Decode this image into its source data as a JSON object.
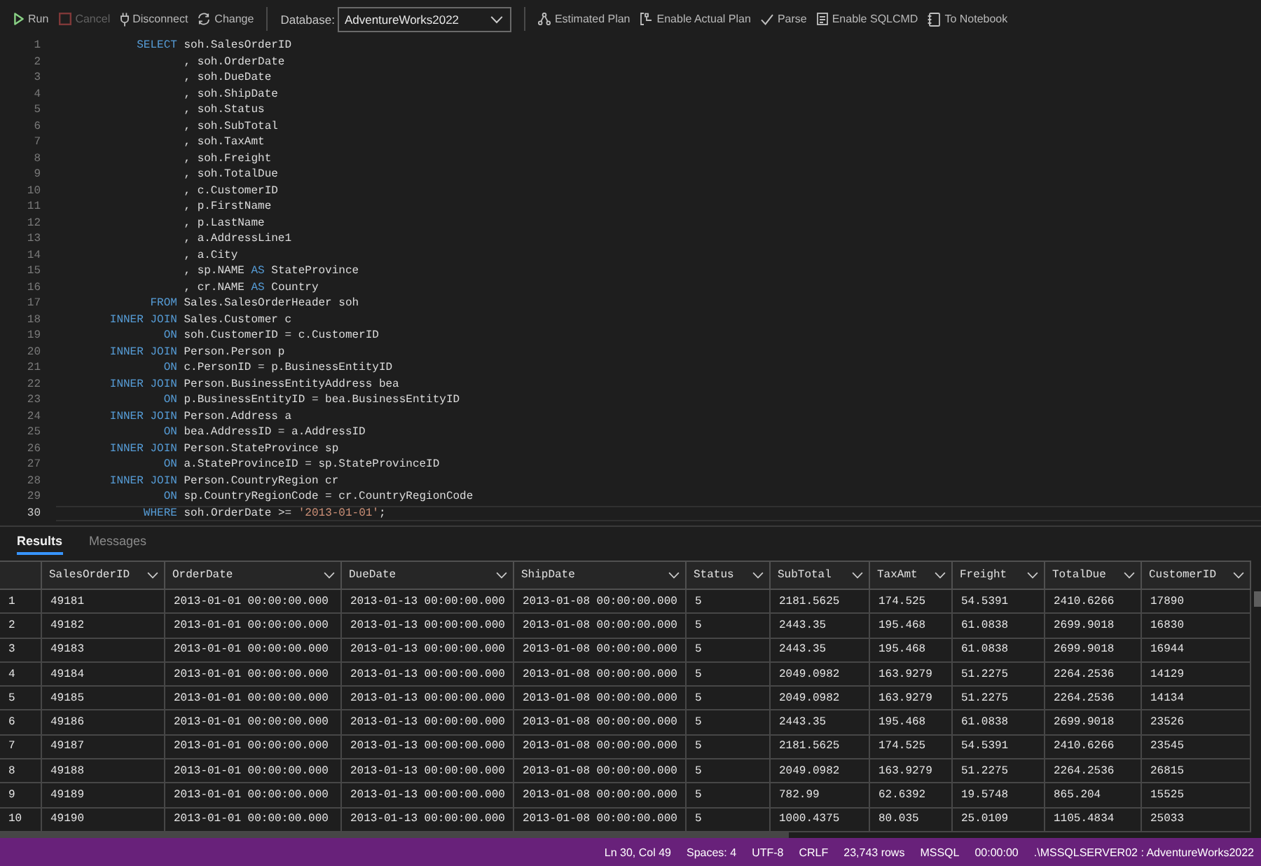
{
  "toolbar": {
    "left_buttons": [
      {
        "label": "Run",
        "disabled": false
      },
      {
        "label": "Cancel",
        "disabled": true
      },
      {
        "label": "Disconnect",
        "disabled": false
      },
      {
        "label": "Change",
        "disabled": false
      }
    ],
    "database": {
      "label": "Database:",
      "value": "AdventureWorks2022"
    },
    "right_buttons": [
      {
        "label": "Estimated Plan"
      },
      {
        "label": "Enable Actual Plan"
      },
      {
        "label": "Parse"
      },
      {
        "label": "Enable SQLCMD"
      },
      {
        "label": "To Notebook"
      }
    ]
  },
  "editor": {
    "lines": [
      {
        "number": "1",
        "current": false,
        "tokens": [
          {
            "kind": "keyword",
            "text": "            SELECT"
          },
          {
            "kind": "plain",
            "text": " soh.SalesOrderID"
          }
        ]
      },
      {
        "number": "2",
        "current": false,
        "tokens": [
          {
            "kind": "plain",
            "text": "                   , soh.OrderDate"
          }
        ]
      },
      {
        "number": "3",
        "current": false,
        "tokens": [
          {
            "kind": "plain",
            "text": "                   , soh.DueDate"
          }
        ]
      },
      {
        "number": "4",
        "current": false,
        "tokens": [
          {
            "kind": "plain",
            "text": "                   , soh.ShipDate"
          }
        ]
      },
      {
        "number": "5",
        "current": false,
        "tokens": [
          {
            "kind": "plain",
            "text": "                   , soh.Status"
          }
        ]
      },
      {
        "number": "6",
        "current": false,
        "tokens": [
          {
            "kind": "plain",
            "text": "                   , soh.SubTotal"
          }
        ]
      },
      {
        "number": "7",
        "current": false,
        "tokens": [
          {
            "kind": "plain",
            "text": "                   , soh.TaxAmt"
          }
        ]
      },
      {
        "number": "8",
        "current": false,
        "tokens": [
          {
            "kind": "plain",
            "text": "                   , soh.Freight"
          }
        ]
      },
      {
        "number": "9",
        "current": false,
        "tokens": [
          {
            "kind": "plain",
            "text": "                   , soh.TotalDue"
          }
        ]
      },
      {
        "number": "10",
        "current": false,
        "tokens": [
          {
            "kind": "plain",
            "text": "                   , c.CustomerID"
          }
        ]
      },
      {
        "number": "11",
        "current": false,
        "tokens": [
          {
            "kind": "plain",
            "text": "                   , p.FirstName"
          }
        ]
      },
      {
        "number": "12",
        "current": false,
        "tokens": [
          {
            "kind": "plain",
            "text": "                   , p.LastName"
          }
        ]
      },
      {
        "number": "13",
        "current": false,
        "tokens": [
          {
            "kind": "plain",
            "text": "                   , a.AddressLine1"
          }
        ]
      },
      {
        "number": "14",
        "current": false,
        "tokens": [
          {
            "kind": "plain",
            "text": "                   , a.City"
          }
        ]
      },
      {
        "number": "15",
        "current": false,
        "tokens": [
          {
            "kind": "plain",
            "text": "                   , sp.NAME "
          },
          {
            "kind": "keyword",
            "text": "AS"
          },
          {
            "kind": "plain",
            "text": " StateProvince"
          }
        ]
      },
      {
        "number": "16",
        "current": false,
        "tokens": [
          {
            "kind": "plain",
            "text": "                   , cr.NAME "
          },
          {
            "kind": "keyword",
            "text": "AS"
          },
          {
            "kind": "plain",
            "text": " Country"
          }
        ]
      },
      {
        "number": "17",
        "current": false,
        "tokens": [
          {
            "kind": "keyword",
            "text": "              FROM"
          },
          {
            "kind": "plain",
            "text": " Sales.SalesOrderHeader soh"
          }
        ]
      },
      {
        "number": "18",
        "current": false,
        "tokens": [
          {
            "kind": "keyword",
            "text": "        INNER JOIN"
          },
          {
            "kind": "plain",
            "text": " Sales.Customer c"
          }
        ]
      },
      {
        "number": "19",
        "current": false,
        "tokens": [
          {
            "kind": "keyword",
            "text": "                ON"
          },
          {
            "kind": "plain",
            "text": " soh.CustomerID = c.CustomerID"
          }
        ]
      },
      {
        "number": "20",
        "current": false,
        "tokens": [
          {
            "kind": "keyword",
            "text": "        INNER JOIN"
          },
          {
            "kind": "plain",
            "text": " Person.Person p"
          }
        ]
      },
      {
        "number": "21",
        "current": false,
        "tokens": [
          {
            "kind": "keyword",
            "text": "                ON"
          },
          {
            "kind": "plain",
            "text": " c.PersonID = p.BusinessEntityID"
          }
        ]
      },
      {
        "number": "22",
        "current": false,
        "tokens": [
          {
            "kind": "keyword",
            "text": "        INNER JOIN"
          },
          {
            "kind": "plain",
            "text": " Person.BusinessEntityAddress bea"
          }
        ]
      },
      {
        "number": "23",
        "current": false,
        "tokens": [
          {
            "kind": "keyword",
            "text": "                ON"
          },
          {
            "kind": "plain",
            "text": " p.BusinessEntityID = bea.BusinessEntityID"
          }
        ]
      },
      {
        "number": "24",
        "current": false,
        "tokens": [
          {
            "kind": "keyword",
            "text": "        INNER JOIN"
          },
          {
            "kind": "plain",
            "text": " Person.Address a"
          }
        ]
      },
      {
        "number": "25",
        "current": false,
        "tokens": [
          {
            "kind": "keyword",
            "text": "                ON"
          },
          {
            "kind": "plain",
            "text": " bea.AddressID = a.AddressID"
          }
        ]
      },
      {
        "number": "26",
        "current": false,
        "tokens": [
          {
            "kind": "keyword",
            "text": "        INNER JOIN"
          },
          {
            "kind": "plain",
            "text": " Person.StateProvince sp"
          }
        ]
      },
      {
        "number": "27",
        "current": false,
        "tokens": [
          {
            "kind": "keyword",
            "text": "                ON"
          },
          {
            "kind": "plain",
            "text": " a.StateProvinceID = sp.StateProvinceID"
          }
        ]
      },
      {
        "number": "28",
        "current": false,
        "tokens": [
          {
            "kind": "keyword",
            "text": "        INNER JOIN"
          },
          {
            "kind": "plain",
            "text": " Person.CountryRegion cr"
          }
        ]
      },
      {
        "number": "29",
        "current": false,
        "tokens": [
          {
            "kind": "keyword",
            "text": "                ON"
          },
          {
            "kind": "plain",
            "text": " sp.CountryRegionCode = cr.CountryRegionCode"
          }
        ]
      },
      {
        "number": "30",
        "current": true,
        "tokens": [
          {
            "kind": "keyword",
            "text": "             WHERE"
          },
          {
            "kind": "plain",
            "text": " soh.OrderDate >= "
          },
          {
            "kind": "string",
            "text": "'2013-01-01'"
          },
          {
            "kind": "plain",
            "text": ";"
          }
        ]
      }
    ]
  },
  "results_panel": {
    "tabs": [
      {
        "label": "Results",
        "selected": true
      },
      {
        "label": "Messages",
        "selected": false
      }
    ],
    "grid": {
      "columns": [
        "SalesOrderID",
        "OrderDate",
        "DueDate",
        "ShipDate",
        "Status",
        "SubTotal",
        "TaxAmt",
        "Freight",
        "TotalDue",
        "CustomerID"
      ],
      "rows": [
        {
          "number": "1",
          "cells": [
            "49181",
            "2013-01-01 00:00:00.000",
            "2013-01-13 00:00:00.000",
            "2013-01-08 00:00:00.000",
            "5",
            "2181.5625",
            "174.525",
            "54.5391",
            "2410.6266",
            "17890"
          ]
        },
        {
          "number": "2",
          "cells": [
            "49182",
            "2013-01-01 00:00:00.000",
            "2013-01-13 00:00:00.000",
            "2013-01-08 00:00:00.000",
            "5",
            "2443.35",
            "195.468",
            "61.0838",
            "2699.9018",
            "16830"
          ]
        },
        {
          "number": "3",
          "cells": [
            "49183",
            "2013-01-01 00:00:00.000",
            "2013-01-13 00:00:00.000",
            "2013-01-08 00:00:00.000",
            "5",
            "2443.35",
            "195.468",
            "61.0838",
            "2699.9018",
            "16944"
          ]
        },
        {
          "number": "4",
          "cells": [
            "49184",
            "2013-01-01 00:00:00.000",
            "2013-01-13 00:00:00.000",
            "2013-01-08 00:00:00.000",
            "5",
            "2049.0982",
            "163.9279",
            "51.2275",
            "2264.2536",
            "14129"
          ]
        },
        {
          "number": "5",
          "cells": [
            "49185",
            "2013-01-01 00:00:00.000",
            "2013-01-13 00:00:00.000",
            "2013-01-08 00:00:00.000",
            "5",
            "2049.0982",
            "163.9279",
            "51.2275",
            "2264.2536",
            "14134"
          ]
        },
        {
          "number": "6",
          "cells": [
            "49186",
            "2013-01-01 00:00:00.000",
            "2013-01-13 00:00:00.000",
            "2013-01-08 00:00:00.000",
            "5",
            "2443.35",
            "195.468",
            "61.0838",
            "2699.9018",
            "23526"
          ]
        },
        {
          "number": "7",
          "cells": [
            "49187",
            "2013-01-01 00:00:00.000",
            "2013-01-13 00:00:00.000",
            "2013-01-08 00:00:00.000",
            "5",
            "2181.5625",
            "174.525",
            "54.5391",
            "2410.6266",
            "23545"
          ]
        },
        {
          "number": "8",
          "cells": [
            "49188",
            "2013-01-01 00:00:00.000",
            "2013-01-13 00:00:00.000",
            "2013-01-08 00:00:00.000",
            "5",
            "2049.0982",
            "163.9279",
            "51.2275",
            "2264.2536",
            "26815"
          ]
        },
        {
          "number": "9",
          "cells": [
            "49189",
            "2013-01-01 00:00:00.000",
            "2013-01-13 00:00:00.000",
            "2013-01-08 00:00:00.000",
            "5",
            "782.99",
            "62.6392",
            "19.5748",
            "865.204",
            "15525"
          ]
        },
        {
          "number": "10",
          "cells": [
            "49190",
            "2013-01-01 00:00:00.000",
            "2013-01-13 00:00:00.000",
            "2013-01-08 00:00:00.000",
            "5",
            "1000.4375",
            "80.035",
            "25.0109",
            "1105.4834",
            "25033"
          ]
        }
      ]
    }
  },
  "status_bar": {
    "items": [
      "Ln 30, Col 49",
      "Spaces: 4",
      "UTF-8",
      "CRLF",
      "23,743 rows",
      "MSSQL",
      "00:00:00",
      ".\\MSSQLSERVER02 : AdventureWorks2022"
    ]
  }
}
